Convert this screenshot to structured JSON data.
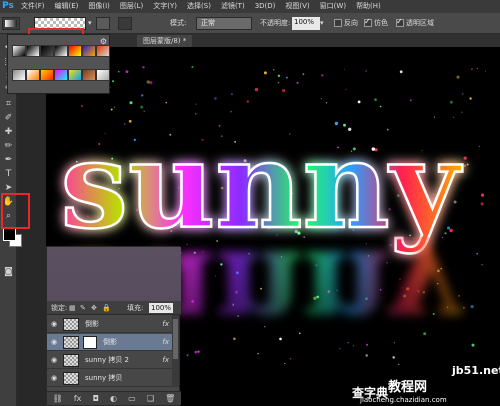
{
  "menubar": {
    "logo": "Ps",
    "items": [
      "文件(F)",
      "编辑(E)",
      "图像(I)",
      "图层(L)",
      "文字(Y)",
      "选择(S)",
      "滤镜(T)",
      "3D(D)",
      "视图(V)",
      "窗口(W)",
      "帮助(H)"
    ]
  },
  "options": {
    "gradient_arrow": "▾",
    "mode_label": "模式:",
    "mode_value": "正常",
    "opacity_label": "不透明度:",
    "opacity_value": "100%",
    "opacity_arrow": "▾",
    "reverse_label": "反向",
    "reverse_checked": false,
    "dither_label": "仿色",
    "dither_checked": true,
    "transparency_label": "透明区域",
    "transparency_checked": true
  },
  "gradient_presets": [
    [
      "#ffffff",
      "#000000"
    ],
    [
      "#000000",
      "#ffffff"
    ],
    [
      "#000000",
      "rgba(0,0,0,0)"
    ],
    [
      "#000000",
      "#ffffff"
    ],
    [
      "#ff0000",
      "#ffff00"
    ],
    [
      "#3a1cc0",
      "#f5a800"
    ],
    [
      "#e23a00",
      "#d8d8d8"
    ],
    [
      "#8a8a8a",
      "#ffffff"
    ],
    [
      "#ffffff",
      "#ff8000"
    ],
    [
      "#ffd000",
      "#ff2000"
    ],
    [
      "#ff00ff",
      "#00ffff"
    ],
    [
      "#ffe000",
      "#00a0ff"
    ],
    [
      "#7a3a1a",
      "#d89060"
    ],
    [
      "#ffffff",
      "#aaaaaa"
    ]
  ],
  "document": {
    "tab_title": "图层蒙版/8) *"
  },
  "canvas_text": {
    "main_word": "sunny",
    "reflection_word": "sunny"
  },
  "layers": {
    "lock_label": "锁定:",
    "fill_label": "填充:",
    "fill_value": "100%",
    "rows": [
      {
        "name": "倒影",
        "selected": false,
        "fx": "fx",
        "has_mask": false
      },
      {
        "name": "倒影",
        "selected": true,
        "fx": "fx",
        "has_mask": true
      },
      {
        "name": "sunny 拷贝 2",
        "selected": false,
        "fx": "fx",
        "has_mask": false
      },
      {
        "name": "sunny 拷贝",
        "selected": false,
        "fx": "",
        "has_mask": false
      }
    ]
  },
  "watermark": {
    "line1": "jb51.net",
    "line2": "教程网",
    "line3": "查字典",
    "line4": "jiaocheng.chazidian.com"
  },
  "colors": {
    "highlight": "#e52a2a",
    "foreground": "#000000",
    "background": "#ffffff",
    "selected_layer": "#6a7a92"
  }
}
